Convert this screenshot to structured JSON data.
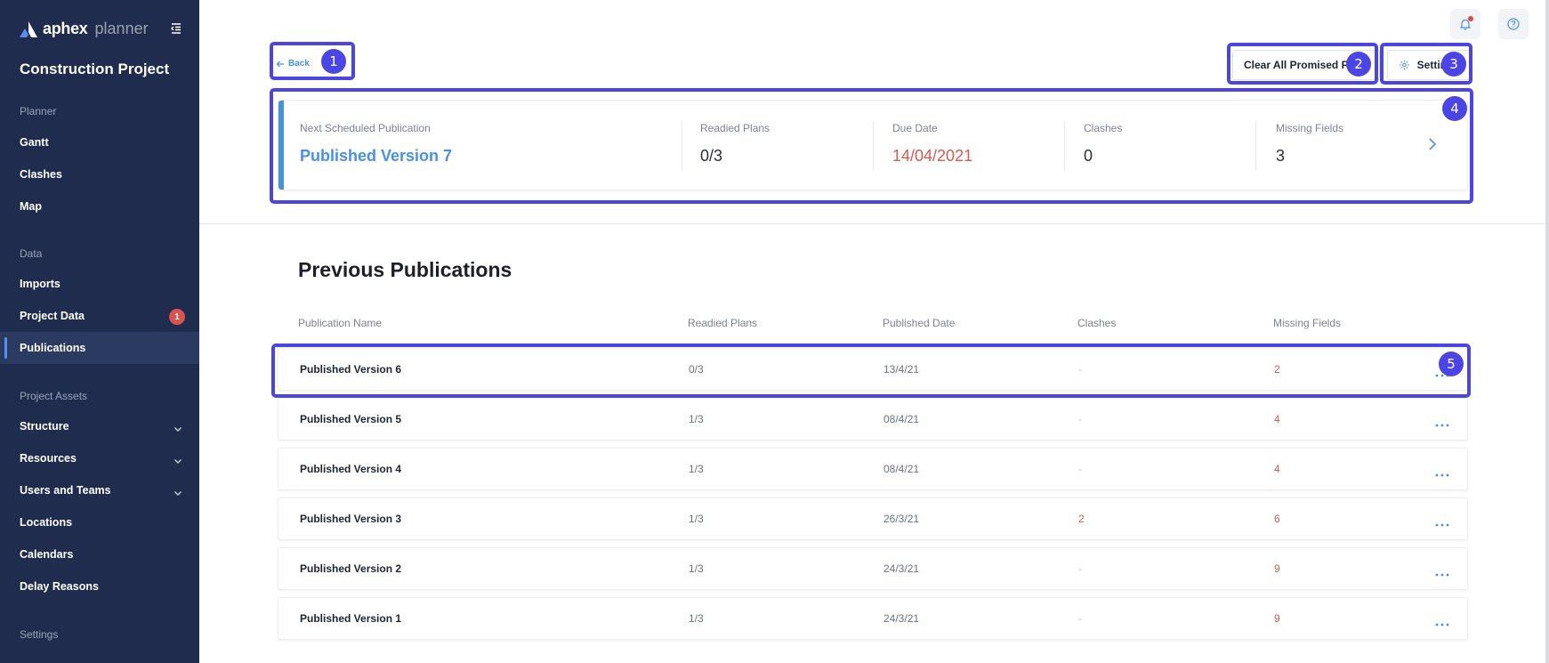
{
  "sidebar": {
    "brand": "aphex",
    "brand_sub": "planner",
    "project_title": "Construction Project",
    "sections": {
      "planner": "Planner",
      "data": "Data",
      "assets": "Project Assets",
      "settings": "Settings"
    },
    "planner_items": [
      "Gantt",
      "Clashes",
      "Map"
    ],
    "data_items": [
      "Imports",
      "Project Data",
      "Publications"
    ],
    "data_badge": "1",
    "asset_items": [
      "Structure",
      "Resources",
      "Users and Teams",
      "Locations",
      "Calendars",
      "Delay Reasons"
    ]
  },
  "header": {
    "back_label": "Back",
    "clear_button": "Clear All Promised Flags",
    "settings_button": "Settings"
  },
  "summary": {
    "next_label": "Next Scheduled Publication",
    "next_value": "Published Version 7",
    "readied_label": "Readied Plans",
    "readied_value": "0/3",
    "due_label": "Due Date",
    "due_value": "14/04/2021",
    "clashes_label": "Clashes",
    "clashes_value": "0",
    "missing_label": "Missing Fields",
    "missing_value": "3"
  },
  "previous": {
    "title": "Previous Publications",
    "columns": [
      "Publication Name",
      "Readied Plans",
      "Published Date",
      "Clashes",
      "Missing Fields"
    ],
    "rows": [
      {
        "name": "Published Version 6",
        "readied": "0/3",
        "date": "13/4/21",
        "clashes": "-",
        "missing": "2"
      },
      {
        "name": "Published Version 5",
        "readied": "1/3",
        "date": "08/4/21",
        "clashes": "-",
        "missing": "4"
      },
      {
        "name": "Published Version 4",
        "readied": "1/3",
        "date": "08/4/21",
        "clashes": "-",
        "missing": "4"
      },
      {
        "name": "Published Version 3",
        "readied": "1/3",
        "date": "26/3/21",
        "clashes": "2",
        "missing": "6"
      },
      {
        "name": "Published Version 2",
        "readied": "1/3",
        "date": "24/3/21",
        "clashes": "-",
        "missing": "9"
      },
      {
        "name": "Published Version 1",
        "readied": "1/3",
        "date": "24/3/21",
        "clashes": "-",
        "missing": "9"
      }
    ]
  },
  "annotations": [
    "1",
    "2",
    "3",
    "4",
    "5"
  ],
  "colors": {
    "sidebar_bg": "#1f2c4d",
    "accent": "#4a90e2",
    "danger": "#d55a4f",
    "annotation": "#4b45e6"
  }
}
